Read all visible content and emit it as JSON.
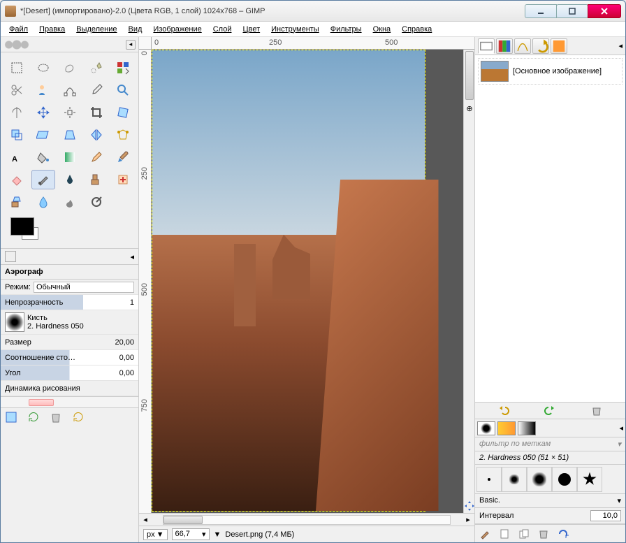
{
  "window": {
    "title": "*[Desert] (импортировано)-2.0 (Цвета RGB, 1 слой) 1024x768 – GIMP"
  },
  "menu": {
    "file": "Файл",
    "edit": "Правка",
    "select": "Выделение",
    "view": "Вид",
    "image": "Изображение",
    "layer": "Слой",
    "colors": "Цвет",
    "tools": "Инструменты",
    "filters": "Фильтры",
    "windows": "Окна",
    "help": "Справка"
  },
  "ruler": {
    "h0": "0",
    "h250": "250",
    "h500": "500",
    "v0": "0",
    "v250": "250",
    "v500": "500",
    "v750": "750"
  },
  "options": {
    "title": "Аэрограф",
    "mode_label": "Режим:",
    "mode_value": "Обычный",
    "opacity_label": "Непрозрачность",
    "opacity_value": "1",
    "brush_label": "Кисть",
    "brush_name": "2. Hardness 050",
    "size_label": "Размер",
    "size_value": "20,00",
    "ratio_label": "Соотношение сто…",
    "ratio_value": "0,00",
    "angle_label": "Угол",
    "angle_value": "0,00",
    "dynamics_label": "Динамика рисования"
  },
  "status": {
    "unit": "px",
    "zoom": "66,7",
    "filename": "Desert.png (7,4 МБ)"
  },
  "layers": {
    "base_name": "[Основное изображение]"
  },
  "brushes": {
    "filter_placeholder": "фильтр по меткам",
    "current": "2. Hardness 050 (51 × 51)",
    "preset": "Basic.",
    "interval_label": "Интервал",
    "interval_value": "10,0"
  }
}
